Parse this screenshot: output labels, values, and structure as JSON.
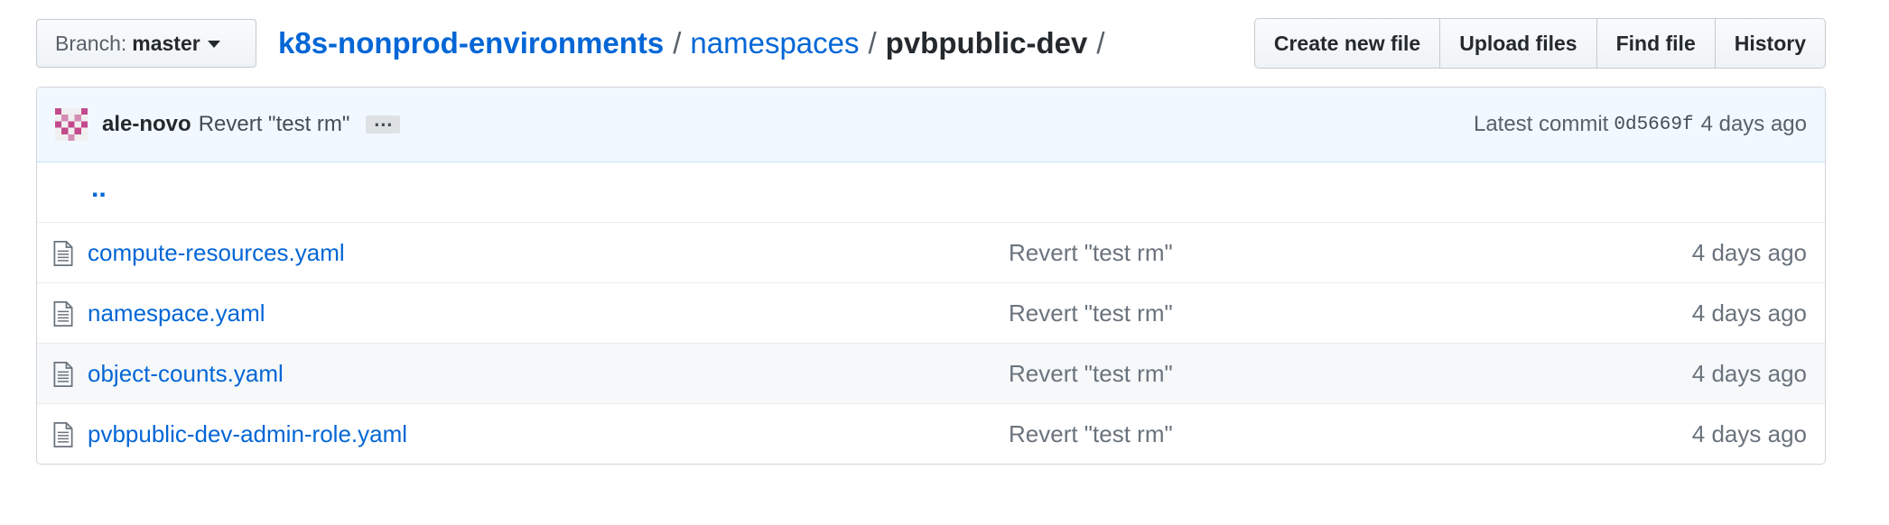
{
  "branch": {
    "label": "Branch:",
    "name": "master"
  },
  "breadcrumb": {
    "repo": "k8s-nonprod-environments",
    "sep": "/",
    "folder": "namespaces",
    "current": "pvbpublic-dev"
  },
  "actions": {
    "create": "Create new file",
    "upload": "Upload files",
    "find": "Find file",
    "history": "History"
  },
  "commit": {
    "author": "ale-novo",
    "message": "Revert \"test rm\"",
    "ellipsis": "…",
    "latest_label": "Latest commit",
    "sha": "0d5669f",
    "age": "4 days ago"
  },
  "parent_link": "..",
  "files": [
    {
      "name": "compute-resources.yaml",
      "message": "Revert \"test rm\"",
      "age": "4 days ago"
    },
    {
      "name": "namespace.yaml",
      "message": "Revert \"test rm\"",
      "age": "4 days ago"
    },
    {
      "name": "object-counts.yaml",
      "message": "Revert \"test rm\"",
      "age": "4 days ago"
    },
    {
      "name": "pvbpublic-dev-admin-role.yaml",
      "message": "Revert \"test rm\"",
      "age": "4 days ago"
    }
  ],
  "icons": {
    "file": "file-text-icon",
    "caret": "caret-down-icon"
  },
  "colors": {
    "link": "#0366d6",
    "commit_bg": "#f1f8ff",
    "avatar": "#c34a8c"
  }
}
